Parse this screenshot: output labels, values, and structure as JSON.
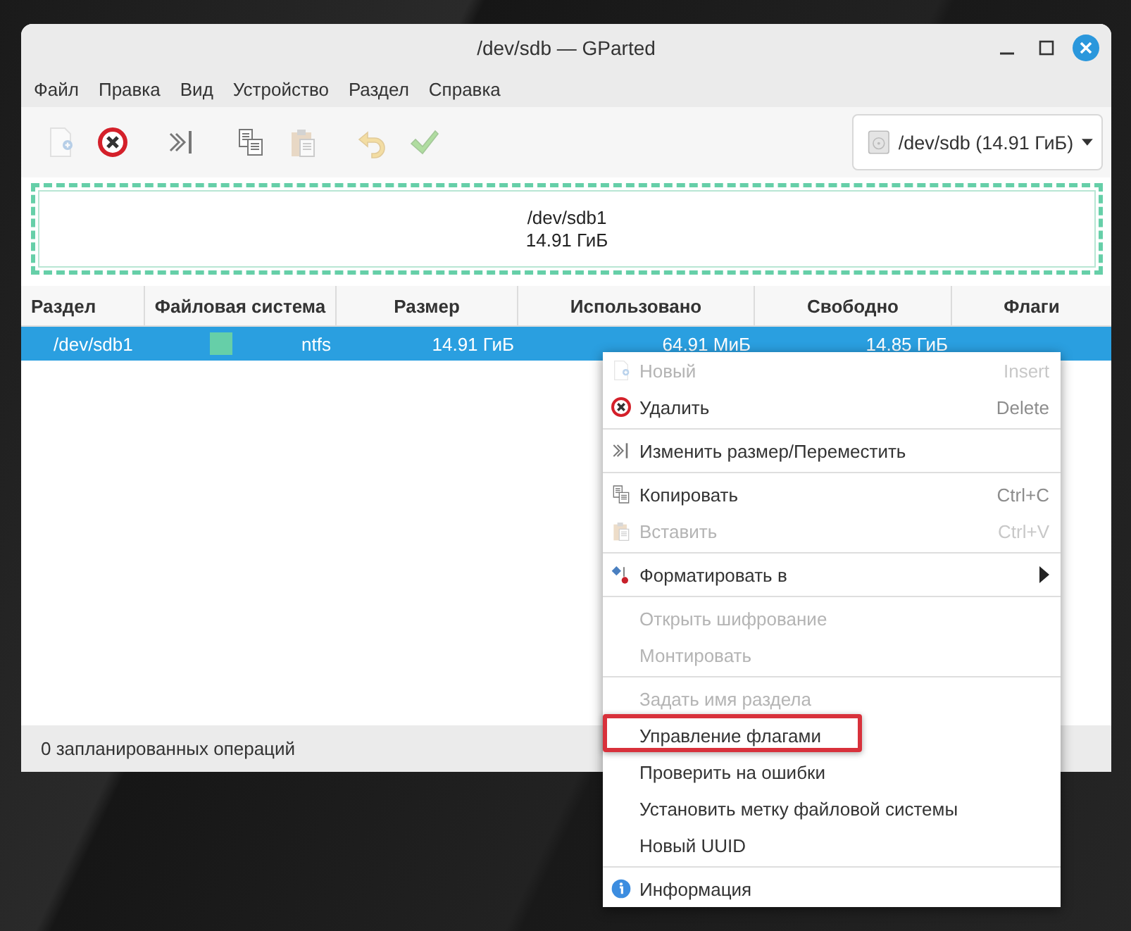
{
  "window": {
    "title": "/dev/sdb — GParted"
  },
  "menu_bar": [
    "Файл",
    "Правка",
    "Вид",
    "Устройство",
    "Раздел",
    "Справка"
  ],
  "toolbar": {
    "groups": [
      [
        {
          "kind": "new",
          "disabled": true
        },
        {
          "kind": "delete",
          "disabled": false
        }
      ],
      [
        {
          "kind": "resize",
          "disabled": false
        }
      ],
      [
        {
          "kind": "copy",
          "disabled": false
        },
        {
          "kind": "paste",
          "disabled": true
        }
      ],
      [
        {
          "kind": "undo",
          "disabled": true
        },
        {
          "kind": "apply",
          "disabled": true
        }
      ]
    ]
  },
  "device_selector": {
    "value": "/dev/sdb (14.91 ГиБ)"
  },
  "disk_map": {
    "partitions": [
      {
        "name": "/dev/sdb1",
        "size": "14.91 ГиБ",
        "color": "#66cfa8",
        "selected": true
      }
    ]
  },
  "table": {
    "columns": [
      "Раздел",
      "Файловая система",
      "Размер",
      "Использовано",
      "Свободно",
      "Флаги"
    ],
    "rows": [
      {
        "partition": "/dev/sdb1",
        "color": "#66cfa8",
        "filesystem": "ntfs",
        "size": "14.91 ГиБ",
        "used": "64.91 МиБ",
        "free": "14.85 ГиБ",
        "selected": true
      }
    ]
  },
  "context_menu": {
    "items": [
      {
        "kind": "new",
        "label": "Новый",
        "shortcut": "Insert",
        "disabled": true
      },
      {
        "kind": "delete",
        "label": "Удалить",
        "shortcut": "Delete",
        "disabled": false
      },
      {
        "kind": "separator"
      },
      {
        "kind": "resize",
        "label": "Изменить размер/Переместить",
        "disabled": false
      },
      {
        "kind": "separator"
      },
      {
        "kind": "copy",
        "label": "Копировать",
        "shortcut": "Ctrl+C",
        "disabled": false
      },
      {
        "kind": "paste",
        "label": "Вставить",
        "shortcut": "Ctrl+V",
        "disabled": true
      },
      {
        "kind": "separator"
      },
      {
        "kind": "format",
        "label": "Форматировать в",
        "submenu": true,
        "disabled": false
      },
      {
        "kind": "separator"
      },
      {
        "kind": "item",
        "label": "Открыть шифрование",
        "disabled": true
      },
      {
        "kind": "item",
        "label": "Монтировать",
        "disabled": true
      },
      {
        "kind": "separator"
      },
      {
        "kind": "item",
        "label": "Задать имя раздела",
        "disabled": true
      },
      {
        "kind": "item",
        "label": "Управление флагами",
        "disabled": false,
        "highlighted": true
      },
      {
        "kind": "item",
        "label": "Проверить на ошибки",
        "disabled": false
      },
      {
        "kind": "item",
        "label": "Установить метку файловой системы",
        "disabled": false
      },
      {
        "kind": "item",
        "label": "Новый UUID",
        "disabled": false
      },
      {
        "kind": "separator"
      },
      {
        "kind": "info",
        "label": "Информация",
        "disabled": false
      }
    ]
  },
  "status_bar": {
    "text": "0 запланированных операций"
  }
}
